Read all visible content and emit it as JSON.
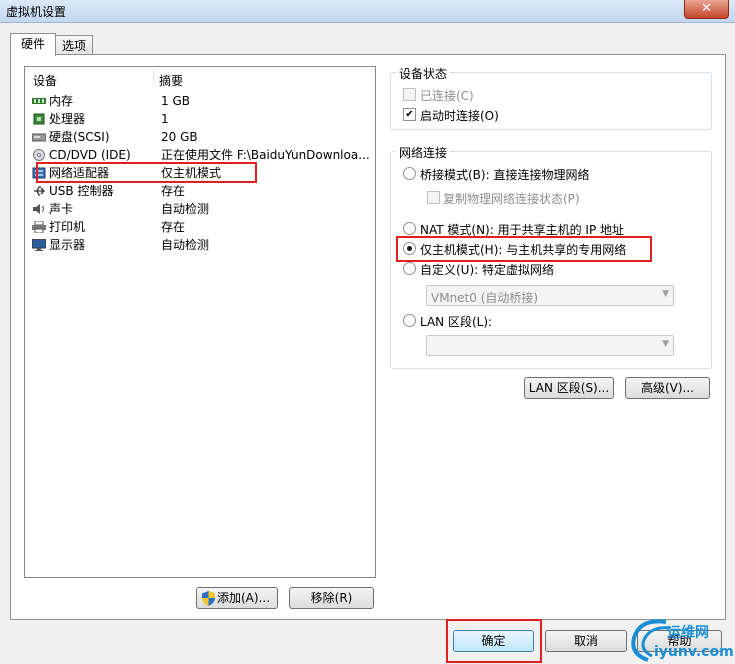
{
  "window": {
    "title": "虚拟机设置",
    "close_label": "✕"
  },
  "tabs": [
    {
      "label": "硬件",
      "active": true
    },
    {
      "label": "选项",
      "active": false
    }
  ],
  "device_list": {
    "headers": {
      "device": "设备",
      "summary": "摘要"
    },
    "items": [
      {
        "name": "内存",
        "summary": "1 GB",
        "icon": "memory-icon"
      },
      {
        "name": "处理器",
        "summary": "1",
        "icon": "processor-icon"
      },
      {
        "name": "硬盘(SCSI)",
        "summary": "20 GB",
        "icon": "hard-disk-icon"
      },
      {
        "name": "CD/DVD (IDE)",
        "summary": "正在使用文件 F:\\BaiduYunDownloa...",
        "icon": "cd-dvd-icon"
      },
      {
        "name": "网络适配器",
        "summary": "仅主机模式",
        "icon": "network-adapter-icon"
      },
      {
        "name": "USB 控制器",
        "summary": "存在",
        "icon": "usb-icon"
      },
      {
        "name": "声卡",
        "summary": "自动检测",
        "icon": "sound-card-icon"
      },
      {
        "name": "打印机",
        "summary": "存在",
        "icon": "printer-icon"
      },
      {
        "name": "显示器",
        "summary": "自动检测",
        "icon": "display-icon"
      }
    ],
    "add_button": "添加(A)...",
    "remove_button": "移除(R)"
  },
  "device_status": {
    "title": "设备状态",
    "connected": {
      "label": "已连接(C)",
      "checked": false,
      "enabled": false
    },
    "connect_at_power_on": {
      "label": "启动时连接(O)",
      "checked": true
    }
  },
  "network_connection": {
    "title": "网络连接",
    "bridged": {
      "label": "桥接模式(B): 直接连接物理网络",
      "selected": false
    },
    "replicate": {
      "label": "复制物理网络连接状态(P)",
      "checked": false,
      "enabled": false
    },
    "nat": {
      "label": "NAT 模式(N): 用于共享主机的 IP 地址",
      "selected": false
    },
    "host_only": {
      "label": "仅主机模式(H): 与主机共享的专用网络",
      "selected": true
    },
    "custom": {
      "label": "自定义(U): 特定虚拟网络",
      "selected": false,
      "dropdown_value": "VMnet0 (自动桥接)"
    },
    "lan_segment": {
      "label": "LAN 区段(L):",
      "selected": false,
      "dropdown_value": ""
    }
  },
  "action_buttons": {
    "lan_segments": "LAN 区段(S)...",
    "advanced": "高级(V)..."
  },
  "footer": {
    "ok": "确定",
    "cancel": "取消",
    "help": "帮助"
  },
  "watermark": {
    "text": "运维网",
    "domain": "iyunv.com"
  },
  "colors": {
    "highlight_box": "#e02020",
    "watermark": "#1a8fd6"
  }
}
